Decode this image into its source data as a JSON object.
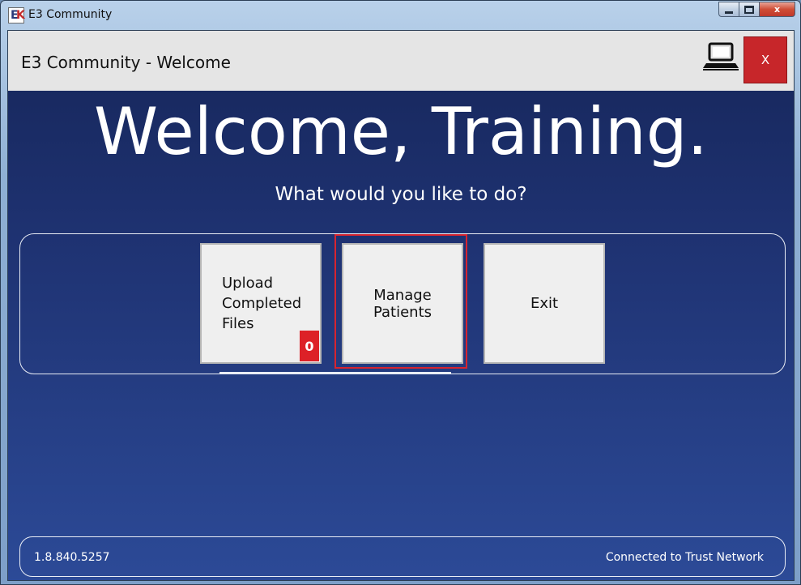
{
  "window": {
    "title": "E3 Community",
    "icon": "ek-logo-icon",
    "controls": [
      "minimize",
      "maximize",
      "close"
    ],
    "close_glyph": "x"
  },
  "header": {
    "title": "E3 Community - Welcome",
    "computer_icon": "computer-icon",
    "close_label": "X"
  },
  "main": {
    "welcome": "Welcome, Training.",
    "prompt": "What would you like to do?",
    "tiles": [
      {
        "label": "Upload\nCompleted\nFiles",
        "badge": "0"
      },
      {
        "label": "Manage Patients",
        "focused": true
      },
      {
        "label": "Exit"
      }
    ]
  },
  "status": {
    "version": "1.8.840.5257",
    "connection": "Connected to Trust Network"
  },
  "colors": {
    "close_button": "#c7262a",
    "badge": "#dd2127",
    "focus_ring": "#d7242f",
    "background_top": "#16265a",
    "background_bottom": "#2c4a97"
  }
}
